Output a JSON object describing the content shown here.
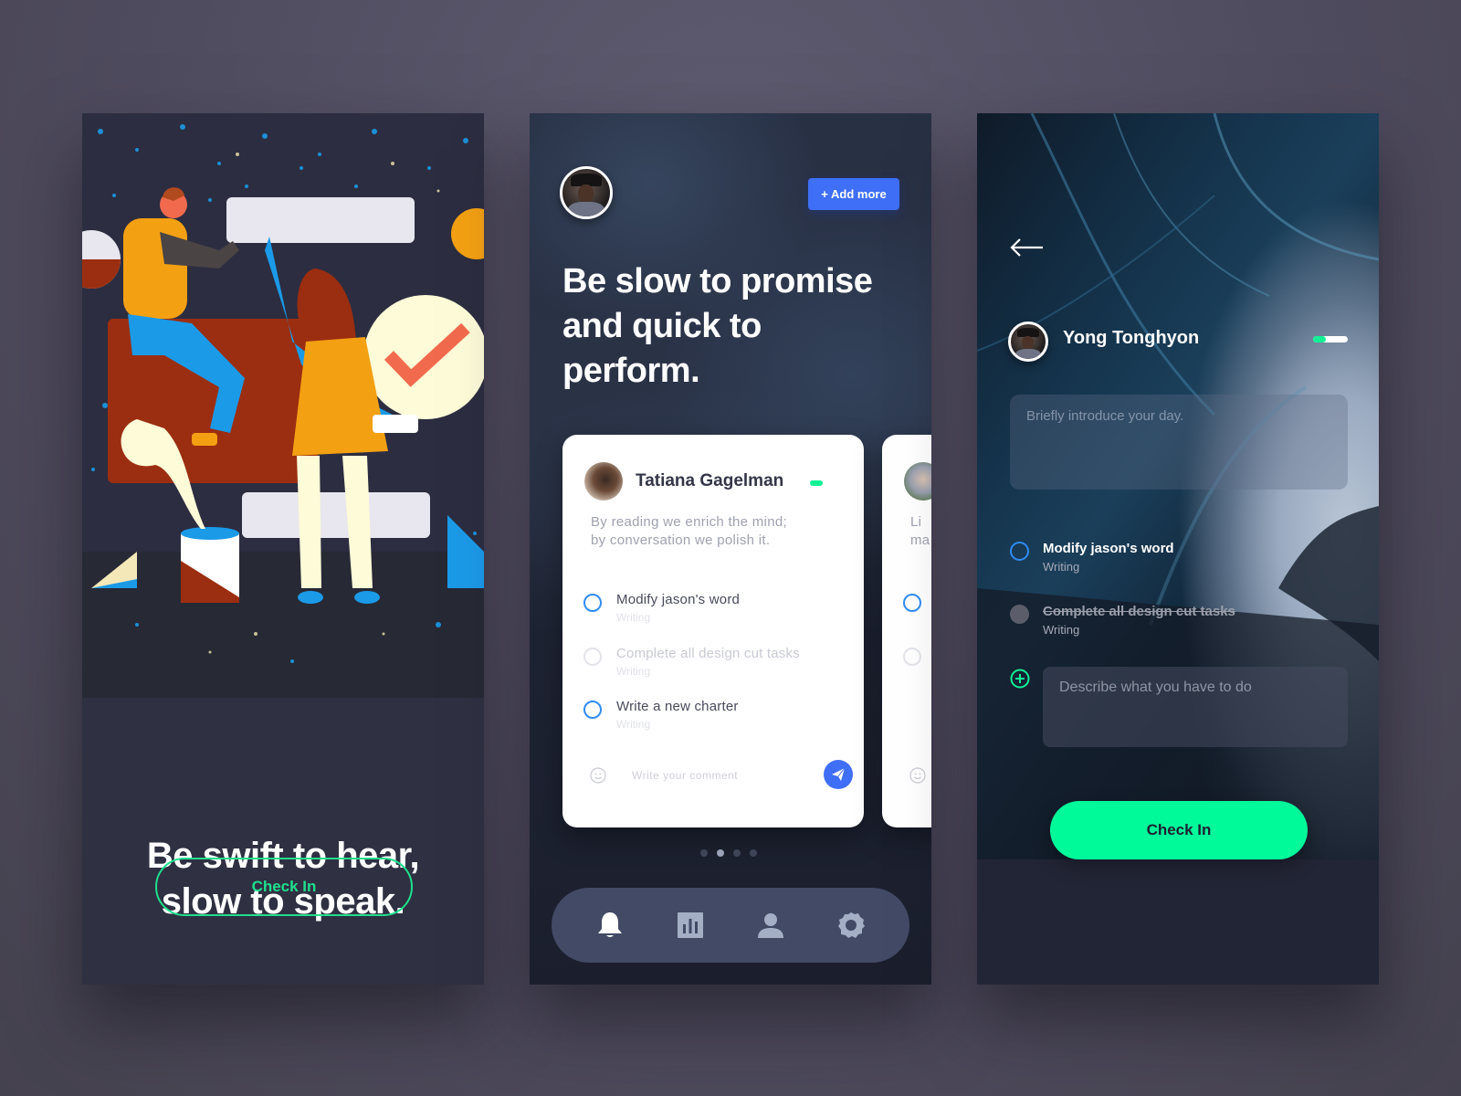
{
  "colors": {
    "accent_green": "#00fa9a",
    "accent_blue": "#3f6ff6",
    "task_ring_blue": "#2f8cf4",
    "status_green": "#13f096"
  },
  "screen1": {
    "illustration": "people-assembling-shapes-illustration",
    "headline_line1": "Be swift to hear,",
    "headline_line2": "slow to speak.",
    "check_in_label": "Check In"
  },
  "screen2": {
    "avatar": "user-avatar",
    "add_more_label": "+ Add more",
    "headline_line1": "Be slow to promise",
    "headline_line2": "and quick to",
    "headline_line3": "perform.",
    "card": {
      "name": "Tatiana Gagelman",
      "status": "online",
      "quote_line1": "By reading we enrich the mind;",
      "quote_line2": "by conversation we polish it.",
      "tasks": [
        {
          "title": "Modify jason's word",
          "category": "Writing",
          "done": false
        },
        {
          "title": "Complete all design cut tasks",
          "category": "Writing",
          "done": true
        },
        {
          "title": "Write a new charter",
          "category": "Writing",
          "done": false
        }
      ],
      "comment_placeholder": "Write your comment"
    },
    "peek_card": {
      "quote_fragment_1": "Li",
      "quote_fragment_2": "ma"
    },
    "pagination": {
      "total": 4,
      "active": 2
    },
    "tabs": [
      {
        "name": "notifications",
        "icon": "bell-icon",
        "active": true
      },
      {
        "name": "stats",
        "icon": "bar-chart-icon",
        "active": false
      },
      {
        "name": "profile",
        "icon": "user-icon",
        "active": false
      },
      {
        "name": "settings",
        "icon": "gear-icon",
        "active": false
      }
    ]
  },
  "screen3": {
    "back_icon": "arrow-left-icon",
    "name": "Yong Tonghyon",
    "toggle_on": true,
    "intro_placeholder": "Briefly introduce your day.",
    "tasks": [
      {
        "title": "Modify jason's word",
        "category": "Writing",
        "done": false
      },
      {
        "title": "Complete all design cut tasks",
        "category": "Writing",
        "done": true
      }
    ],
    "describe_placeholder": "Describe what you have to do",
    "check_in_label": "Check In"
  }
}
